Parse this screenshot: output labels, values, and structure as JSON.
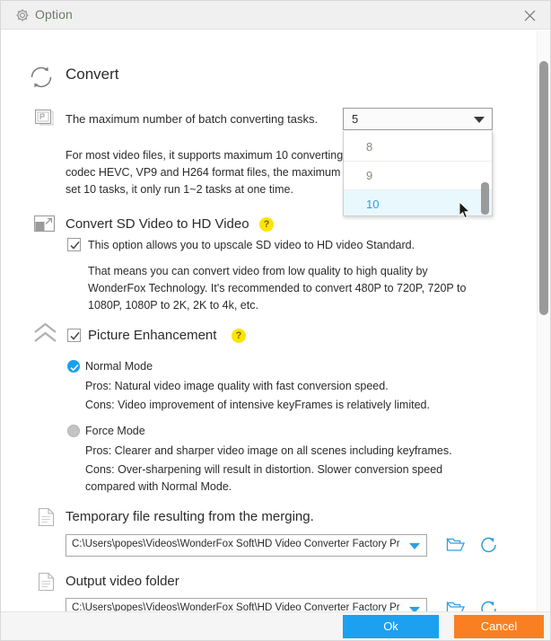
{
  "titlebar": {
    "title": "Option",
    "gear_icon": "gear-icon",
    "close_icon": "close-icon"
  },
  "convert_section": {
    "icon": "convert-refresh-icon",
    "heading": "Convert",
    "batch": {
      "icon": "film-strip-icon",
      "label": "The maximum number of batch converting tasks.",
      "selected_value": "5",
      "description": "For most video files, it supports maximum 10 converting tasks at one time. For the codec HEVC, VP9 and H264 format files, the maximum number is 2 items even if you set 10 tasks, it only run 1~2 tasks at one time.",
      "dropdown_options": [
        "8",
        "9",
        "10"
      ],
      "highlighted_option": "10"
    }
  },
  "sd_to_hd": {
    "icon": "upscale-arrow-icon",
    "heading": "Convert SD Video to HD Video",
    "help_icon": "question-mark-icon",
    "checkbox_checked": true,
    "checkbox_label": "This option allows you to upscale SD video to HD video Standard.",
    "description": "That means you can convert video from low quality to high quality by WonderFox Technology. It's recommended to convert 480P to 720P, 720P to 1080P, 1080P to 2K, 2K to 4k, etc."
  },
  "picture_enhancement": {
    "icon": "double-chevron-up-icon",
    "heading": "Picture Enhancement",
    "help_icon": "question-mark-icon",
    "checkbox_checked": true,
    "modes": [
      {
        "label": "Normal Mode",
        "selected": true,
        "pros": "Pros: Natural video image quality with fast conversion speed.",
        "cons": "Cons: Video improvement of intensive keyFrames is relatively limited."
      },
      {
        "label": "Force Mode",
        "selected": false,
        "pros": "Pros: Clearer and sharper video image on all scenes including keyframes.",
        "cons": "Cons: Over-sharpening will result in distortion. Slower conversion speed compared  with Normal Mode."
      }
    ]
  },
  "temp_file": {
    "icon": "document-icon",
    "heading": "Temporary file resulting from the merging.",
    "path": "C:\\Users\\popes\\Videos\\WonderFox Soft\\HD Video Converter Factory Pro\\Mer",
    "folder_icon": "open-folder-icon",
    "refresh_icon": "refresh-icon"
  },
  "output_folder": {
    "icon": "document-icon",
    "heading": "Output video folder",
    "path": "C:\\Users\\popes\\Videos\\WonderFox Soft\\HD Video Converter Factory Pro\\Out",
    "folder_icon": "open-folder-icon",
    "refresh_icon": "refresh-icon"
  },
  "footer": {
    "ok_label": "Ok",
    "cancel_label": "Cancel"
  },
  "colors": {
    "accent_blue": "#1ca0f0",
    "cancel_orange": "#f88022",
    "help_yellow": "#ffe400",
    "highlight_row": "#e8f8fd"
  }
}
